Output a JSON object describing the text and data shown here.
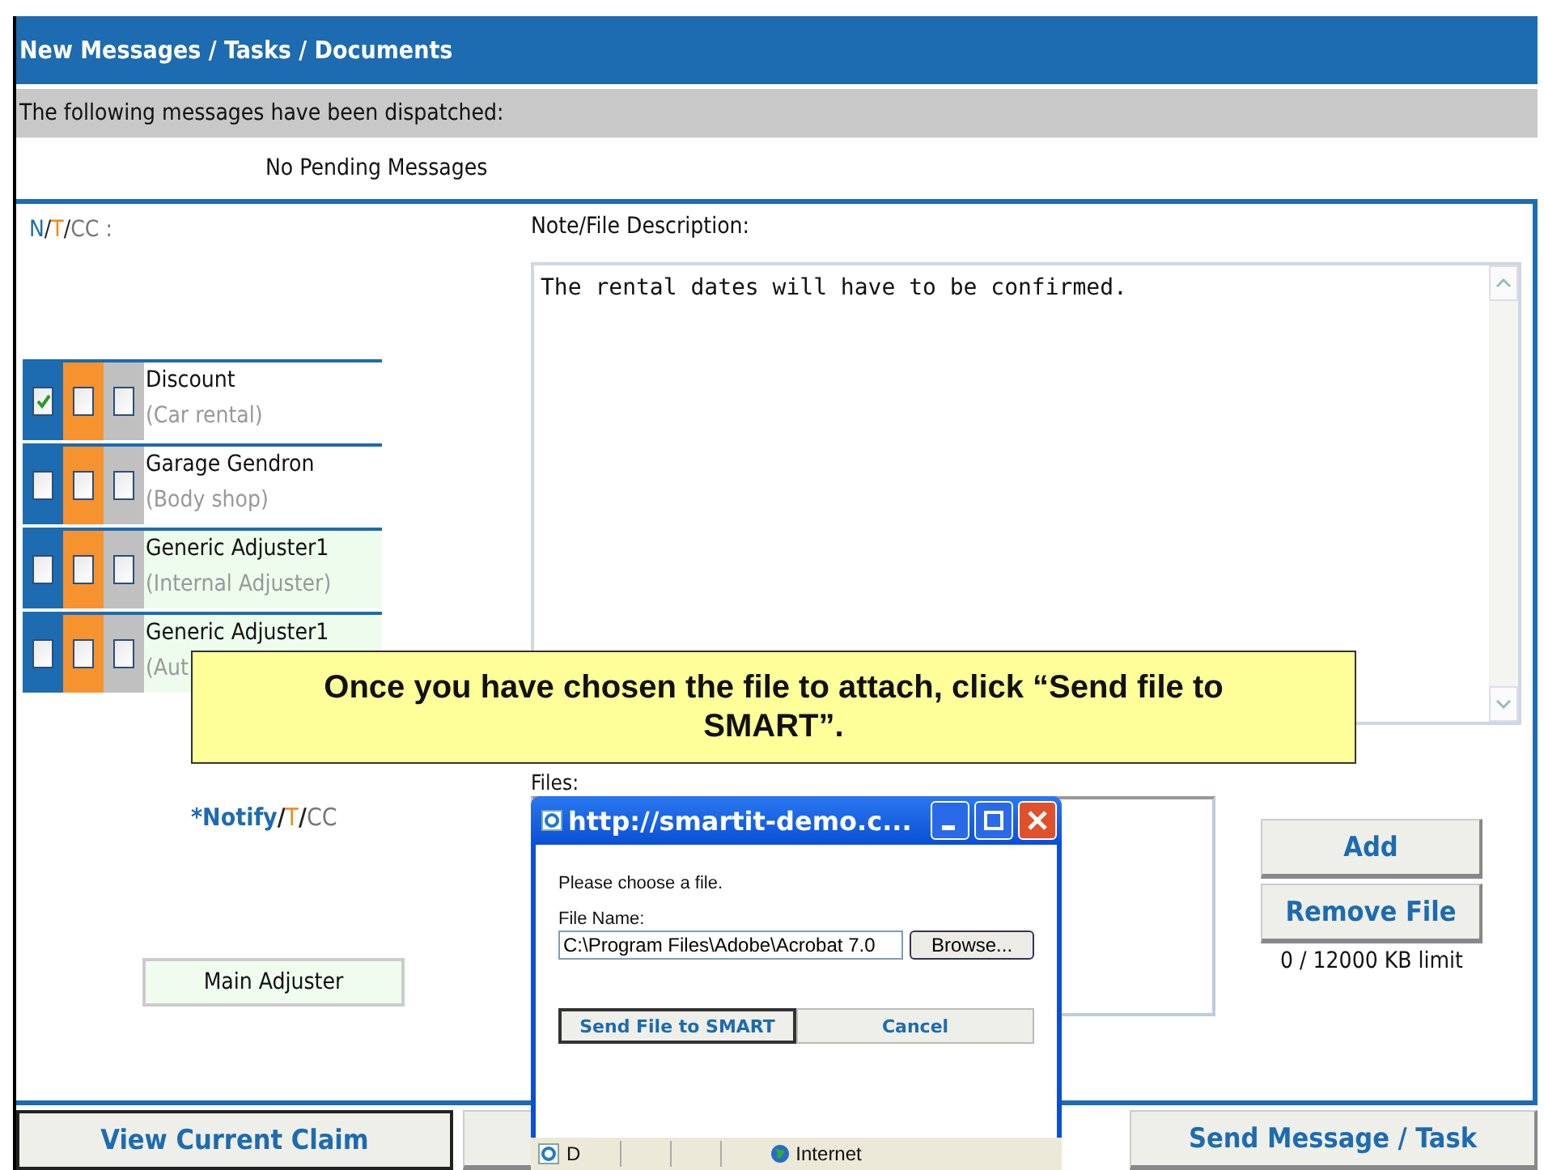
{
  "header": {
    "title": "New Messages / Tasks / Documents"
  },
  "dispatched": {
    "label": "The following messages have been dispatched:",
    "status": "No Pending Messages"
  },
  "legend": [
    {
      "kind": "notify",
      "text": "N"
    },
    {
      "kind": "plain",
      "text": "/"
    },
    {
      "kind": "to",
      "text": "T"
    },
    {
      "kind": "plain",
      "text": "/"
    },
    {
      "kind": "cc",
      "text": "CC :"
    }
  ],
  "recipients": [
    {
      "name": "Discount",
      "role": "(Car rental)",
      "highlighted": false,
      "notify": true,
      "to": false,
      "cc": false
    },
    {
      "name": "Garage Gendron",
      "role": "(Body shop)",
      "highlighted": false,
      "notify": false,
      "to": false,
      "cc": false
    },
    {
      "name": "Generic Adjuster1",
      "role": "(Internal Adjuster)",
      "highlighted": true,
      "notify": false,
      "to": false,
      "cc": false
    },
    {
      "name": "Generic Adjuster1",
      "role": "(Aut",
      "highlighted": true,
      "notify": false,
      "to": false,
      "cc": false
    }
  ],
  "notify_legend": [
    {
      "kind": "notify",
      "text": "*Notify"
    },
    {
      "kind": "plain",
      "text": "/"
    },
    {
      "kind": "to",
      "text": "T"
    },
    {
      "kind": "plain",
      "text": "/"
    },
    {
      "kind": "cc",
      "text": "CC"
    }
  ],
  "main_adjuster": "Main Adjuster",
  "note": {
    "label": "Note/File Description:",
    "value": "The rental dates will have to be confirmed."
  },
  "files": {
    "label": "Files:",
    "add": "Add",
    "remove": "Remove File",
    "limit": "0 / 12000 KB limit"
  },
  "footer": {
    "view_claim": "View Current Claim",
    "send": "Send Message / Task"
  },
  "callout": "Once you have chosen the file to attach, click “Send file to SMART”.",
  "dialog": {
    "title": "http://smartit-demo.c...",
    "prompt": "Please choose a file.",
    "field_label": "File Name:",
    "file_value": "C:\\Program Files\\Adobe\\Acrobat 7.0",
    "browse": "Browse...",
    "send": "Send File to SMART",
    "cancel": "Cancel",
    "status_d": "D",
    "zone": "Internet"
  }
}
